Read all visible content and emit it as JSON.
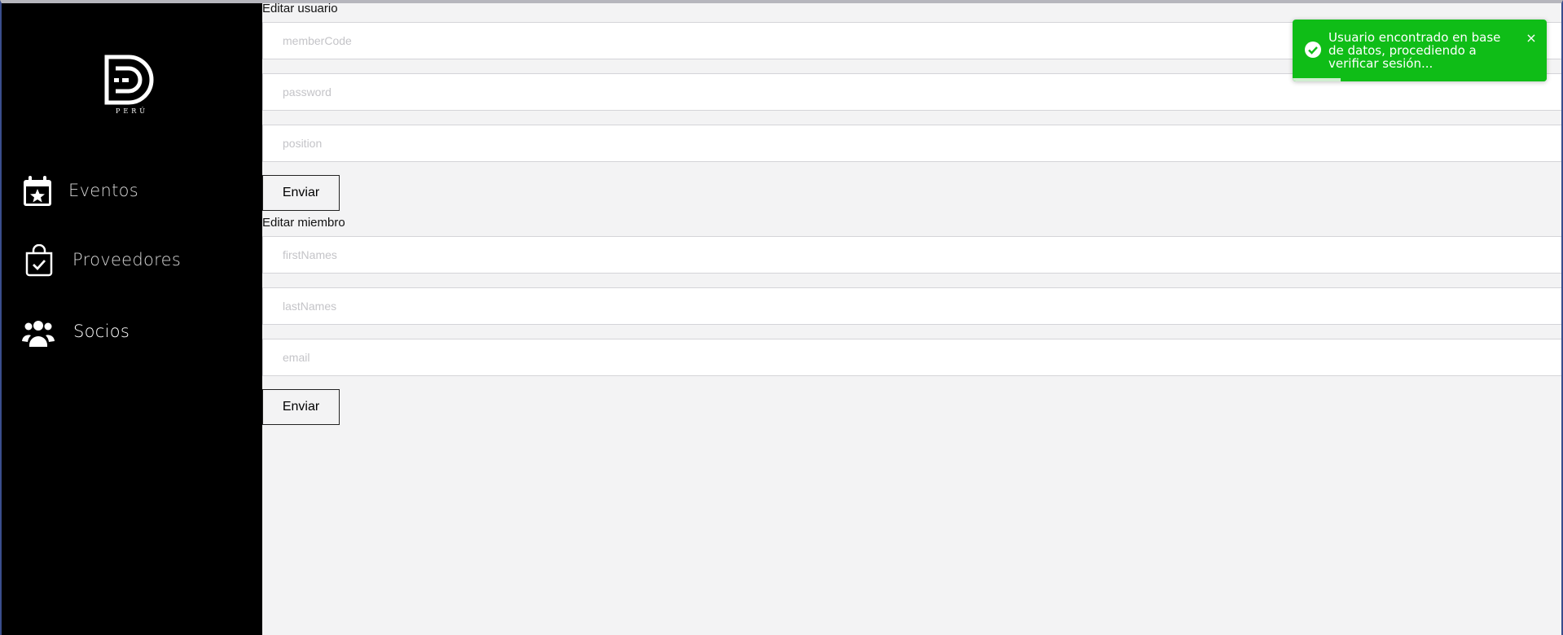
{
  "sidebar": {
    "logo_text": "PERÚ",
    "items": [
      {
        "label": "Eventos",
        "icon": "calendar-star-icon"
      },
      {
        "label": "Proveedores",
        "icon": "shopping-bag-check-icon"
      },
      {
        "label": "Socios",
        "icon": "users-group-icon"
      }
    ]
  },
  "user_form": {
    "title": "Editar usuario",
    "fields": [
      {
        "placeholder": "memberCode",
        "value": ""
      },
      {
        "placeholder": "password",
        "value": ""
      },
      {
        "placeholder": "position",
        "value": ""
      }
    ],
    "submit_label": "Enviar"
  },
  "member_form": {
    "title": "Editar miembro",
    "fields": [
      {
        "placeholder": "firstNames",
        "value": ""
      },
      {
        "placeholder": "lastNames",
        "value": ""
      },
      {
        "placeholder": "email",
        "value": ""
      }
    ],
    "submit_label": "Enviar"
  },
  "toast": {
    "message": "Usuario encontrado en base de datos, procediendo a verificar sesión...",
    "close_label": "×",
    "status": "success",
    "progress_remaining": 0.19,
    "colors": {
      "background": "#0fbd17",
      "text": "#ffffff"
    }
  },
  "colors": {
    "sidebar_background": "#000000",
    "main_background": "#f3f3f4"
  }
}
